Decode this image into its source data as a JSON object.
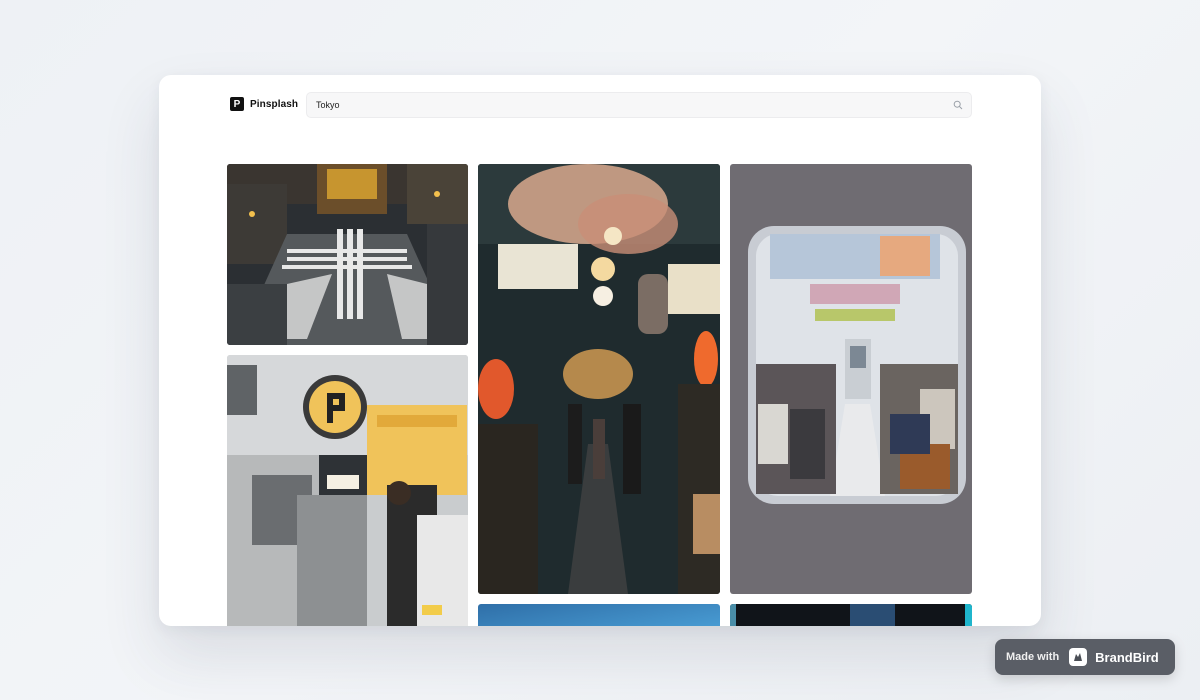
{
  "app": {
    "logo_mark": "P",
    "name": "Pinsplash"
  },
  "search": {
    "value": "Tokyo",
    "icon": "search-icon"
  },
  "gallery": {
    "photos": [
      {
        "subject": "crossing",
        "icon": "shibuya-crossing-photo"
      },
      {
        "subject": "parking",
        "icon": "parking-street-photo"
      },
      {
        "subject": "alley",
        "icon": "lantern-alley-photo"
      },
      {
        "subject": "sky",
        "icon": "blue-sky-photo"
      },
      {
        "subject": "train",
        "icon": "train-interior-photo"
      },
      {
        "subject": "neon",
        "icon": "neon-night-photo"
      }
    ]
  },
  "watermark": {
    "made_with": "Made with",
    "brand": "BrandBird"
  },
  "colors": {
    "background": "#eef1f5",
    "window": "#ffffff",
    "badge": "#5a5e66",
    "logo": "#111111"
  }
}
